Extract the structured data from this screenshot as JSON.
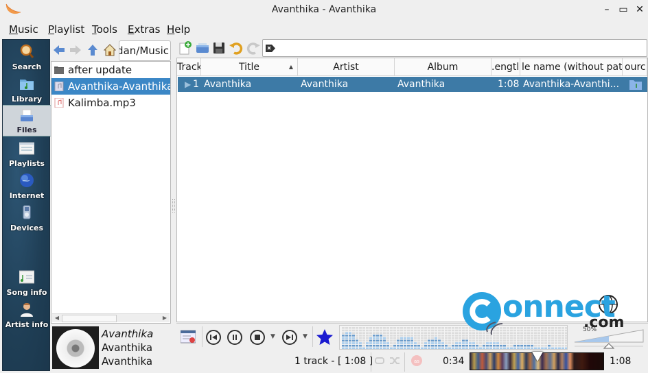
{
  "window": {
    "title": "Avanthika - Avanthika",
    "minimize_label": "minimize",
    "maximize_label": "maximize",
    "close_label": "close"
  },
  "menu": {
    "items": [
      {
        "label": "Music",
        "mnemonic": "M",
        "rest": "usic"
      },
      {
        "label": "Playlist",
        "mnemonic": "P",
        "rest": "laylist"
      },
      {
        "label": "Tools",
        "mnemonic": "T",
        "rest": "ools"
      },
      {
        "label": "Extras",
        "mnemonic": "E",
        "rest": "xtras"
      },
      {
        "label": "Help",
        "mnemonic": "H",
        "rest": "elp"
      }
    ]
  },
  "sidebar": {
    "items": [
      {
        "label": "Search",
        "icon": "search-icon"
      },
      {
        "label": "Library",
        "icon": "library-folder-icon"
      },
      {
        "label": "Files",
        "icon": "files-icon",
        "active": true
      },
      {
        "label": "Playlists",
        "icon": "playlists-icon"
      },
      {
        "label": "Internet",
        "icon": "globe-icon"
      },
      {
        "label": "Devices",
        "icon": "device-icon"
      },
      {
        "label": "Song info",
        "icon": "song-info-icon"
      },
      {
        "label": "Artist info",
        "icon": "artist-icon"
      }
    ]
  },
  "file_browser": {
    "path": "dan/Music",
    "files": [
      {
        "name": "after update",
        "type": "folder"
      },
      {
        "name": "Avanthika-Avanthika-",
        "type": "audio",
        "selected": true
      },
      {
        "name": "Kalimba.mp3",
        "type": "audio"
      }
    ]
  },
  "now_playing": {
    "title": "Avanthika",
    "artist": "Avanthika",
    "album": "Avanthika"
  },
  "playlist": {
    "columns": [
      "Track",
      "Title",
      "Artist",
      "Album",
      "Length",
      "File name (without path)",
      "Source"
    ],
    "columns_visible": [
      "Track",
      "Title",
      "Artist",
      "Album",
      ".engtl",
      "le name (without pat",
      "ourc"
    ],
    "sort_column": "Title",
    "rows": [
      {
        "track": "1",
        "title": "Avanthika",
        "artist": "Avanthika",
        "album": "Avanthika",
        "length": "1:08",
        "filename": "Avanthika-Avanthi...",
        "playing": true
      }
    ]
  },
  "controls": {
    "volume_percent": 50,
    "volume_label": "50%"
  },
  "status": {
    "track_count": "1 track - [ 1:08 ]",
    "elapsed": "0:34",
    "total": "1:08",
    "progress_fraction": 0.5
  },
  "watermark": {
    "text": "onnect",
    "suffix": ".com"
  }
}
